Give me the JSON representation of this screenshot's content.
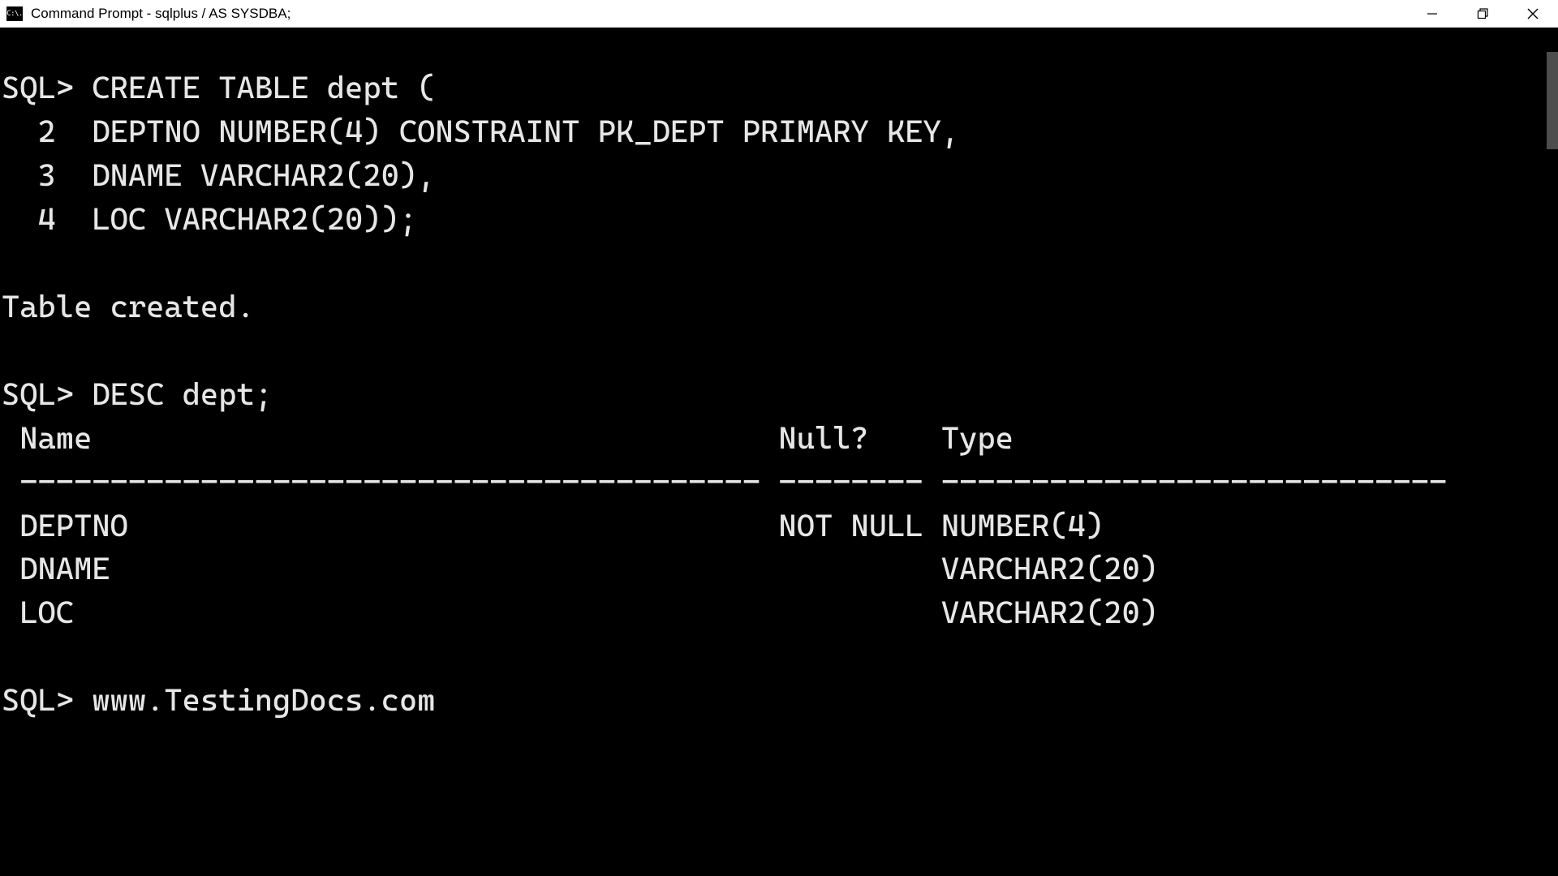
{
  "titlebar": {
    "icon_text": "C:\\.",
    "title": "Command Prompt - sqlplus  / AS SYSDBA;"
  },
  "terminal": {
    "lines": [
      "SQL> CREATE TABLE dept (",
      "  2  DEPTNO NUMBER(4) CONSTRAINT PK_DEPT PRIMARY KEY,",
      "  3  DNAME VARCHAR2(20),",
      "  4  LOC VARCHAR2(20));",
      "",
      "Table created.",
      "",
      "SQL> DESC dept;",
      " Name                                      Null?    Type",
      " ----------------------------------------- -------- ----------------------------",
      " DEPTNO                                    NOT NULL NUMBER(4)",
      " DNAME                                              VARCHAR2(20)",
      " LOC                                                VARCHAR2(20)",
      "",
      "SQL> www.TestingDocs.com"
    ]
  }
}
